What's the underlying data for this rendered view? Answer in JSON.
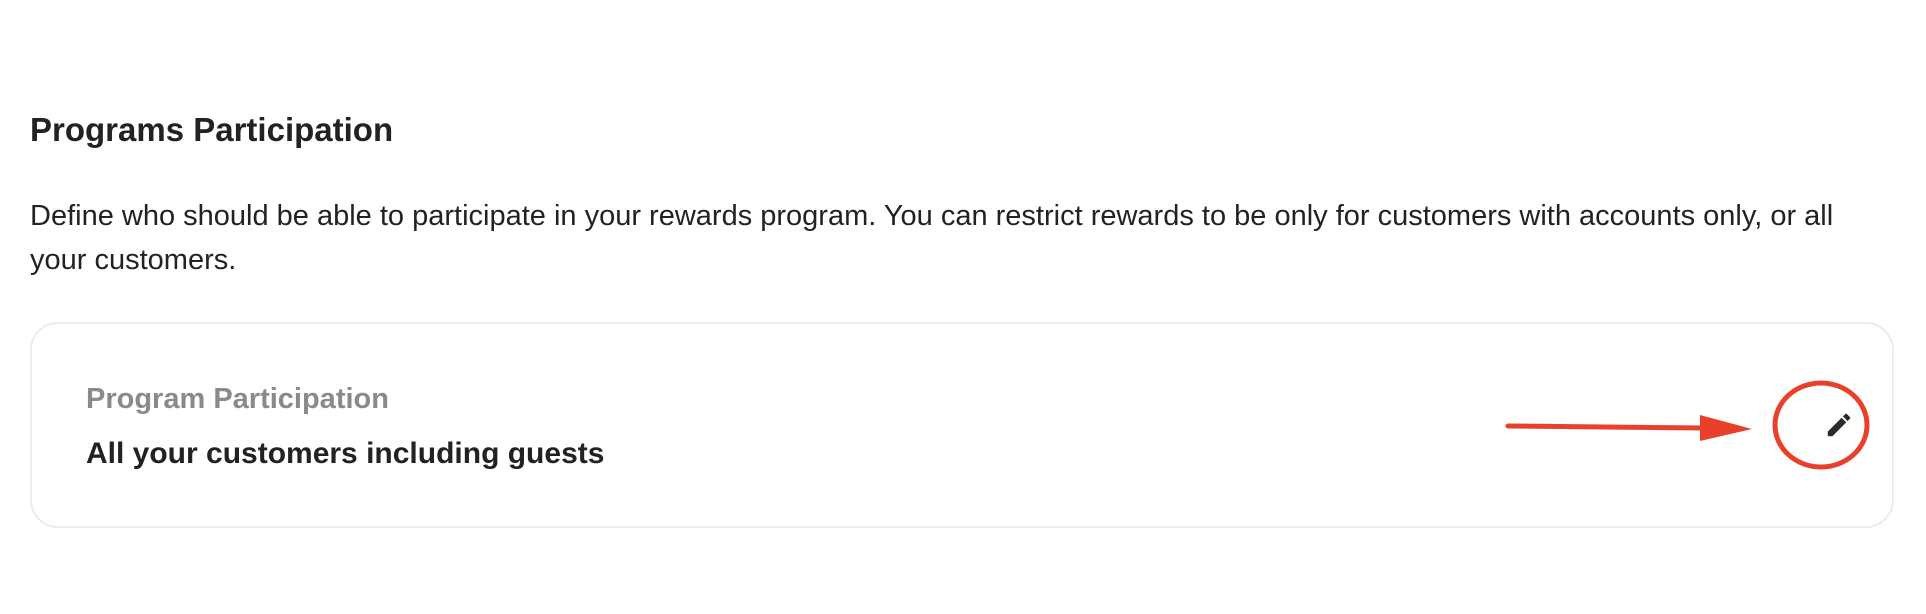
{
  "section": {
    "title": "Programs Participation",
    "description": "Define who should be able to participate in your rewards program. You can restrict rewards to be only for customers with accounts only, or all your customers."
  },
  "card": {
    "label": "Program Participation",
    "value": "All your customers including guests",
    "edit_icon": "pencil-icon"
  },
  "annotation": {
    "color": "#e8402a"
  },
  "colors": {
    "text_primary": "#222222",
    "text_muted": "#8a8a8a",
    "card_border": "#ececec"
  }
}
